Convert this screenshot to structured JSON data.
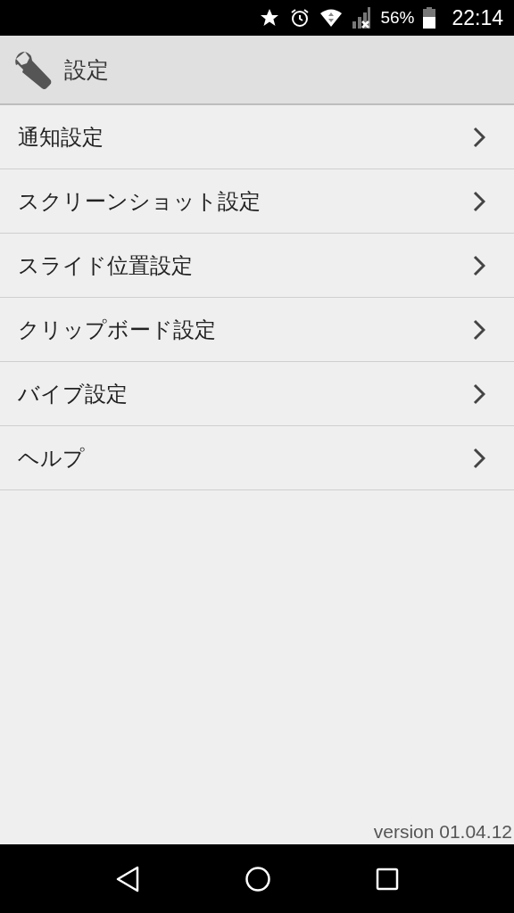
{
  "status_bar": {
    "battery": "56%",
    "time": "22:14"
  },
  "header": {
    "title": "設定"
  },
  "menu_items": [
    {
      "label": "通知設定"
    },
    {
      "label": "スクリーンショット設定"
    },
    {
      "label": "スライド位置設定"
    },
    {
      "label": "クリップボード設定"
    },
    {
      "label": "バイブ設定"
    },
    {
      "label": "ヘルプ"
    }
  ],
  "footer": {
    "version": "version 01.04.12"
  }
}
